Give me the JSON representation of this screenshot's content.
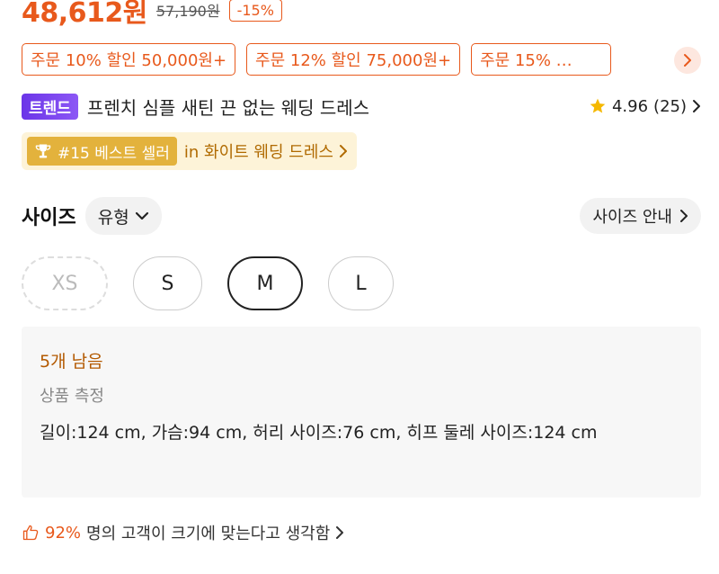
{
  "price": {
    "current": "48,612원",
    "original": "57,190원",
    "discount": "-15%"
  },
  "coupons": [
    "주문 10% 할인 50,000원+",
    "주문 12% 할인 75,000원+",
    "주문 15% …"
  ],
  "product": {
    "badge": "트렌드",
    "title": "프렌치 심플 새틴 끈 없는 웨딩 드레스",
    "rating": "4.96",
    "review_count": "(25)"
  },
  "best_seller": {
    "rank": "#15 베스트 셀러",
    "category": "in 화이트 웨딩 드레스"
  },
  "size_section": {
    "label": "사이즈",
    "type_button": "유형",
    "guide_button": "사이즈 안내",
    "options": [
      "XS",
      "S",
      "M",
      "L"
    ],
    "selected": "M",
    "disabled": [
      "XS"
    ]
  },
  "info": {
    "stock": "5개 남음",
    "measure_title": "상품 측정",
    "measure_text": "길이:124 cm,  가슴:94 cm,  허리 사이즈:76 cm,  히프 둘레 사이즈:124 cm"
  },
  "fit": {
    "percent": "92%",
    "text": "명의 고객이 크기에 맞는다고 생각함"
  },
  "colors": {
    "accent": "#e8591c",
    "trend": "#6b35e8",
    "gold": "#e3b23c"
  }
}
